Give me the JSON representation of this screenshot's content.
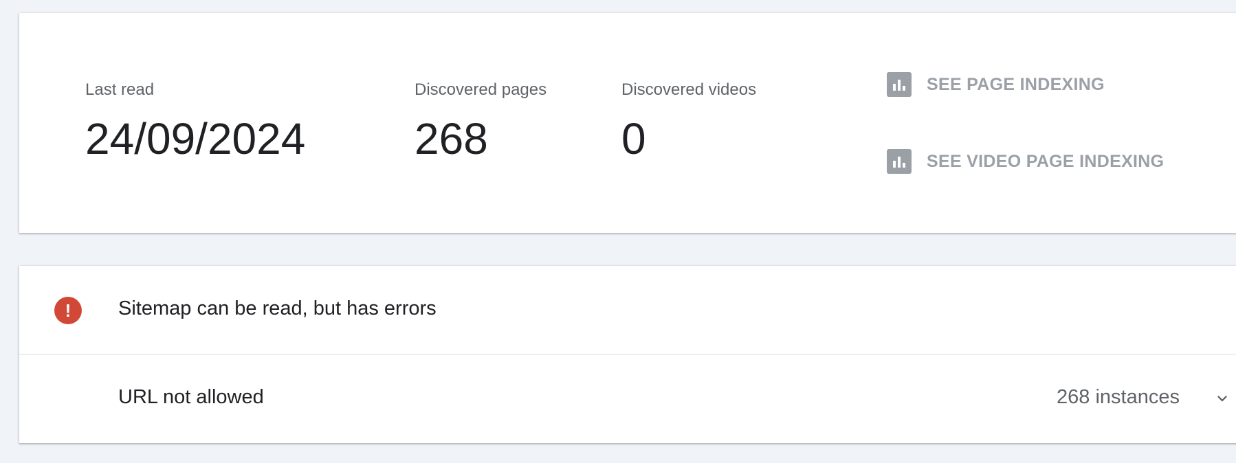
{
  "summary": {
    "last_read_label": "Last read",
    "last_read_value": "24/09/2024",
    "discovered_pages_label": "Discovered pages",
    "discovered_pages_value": "268",
    "discovered_videos_label": "Discovered videos",
    "discovered_videos_value": "0"
  },
  "links": {
    "page_indexing": "SEE PAGE INDEXING",
    "video_page_indexing": "SEE VIDEO PAGE INDEXING",
    "icon": "bar-chart-icon"
  },
  "status": {
    "icon": "error-icon",
    "icon_glyph": "!",
    "text": "Sitemap can be read, but has errors",
    "color": "#d14836"
  },
  "issues": [
    {
      "title": "URL not allowed",
      "count": "268 instances",
      "icon": "chevron-down-icon"
    }
  ]
}
